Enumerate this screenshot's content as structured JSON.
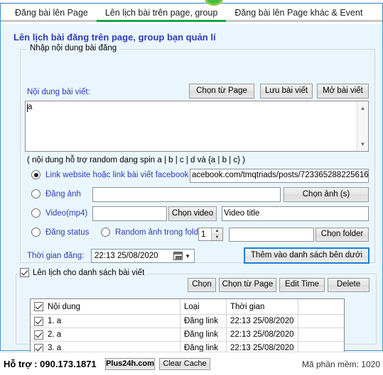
{
  "window": {
    "logo": "plus24h-logo-circle"
  },
  "tabs": [
    {
      "label": "Đăng bài lên Page",
      "active": false
    },
    {
      "label": "Lên lịch bài trên page, group",
      "active": true
    },
    {
      "label": "Đăng bài lên Page khác & Event",
      "active": false
    }
  ],
  "page": {
    "title": "Lên lịch bài đăng trên page, group bạn quản lí"
  },
  "content_group": {
    "legend": "Nhập nội dung bài đăng",
    "content_label": "Nội dung bài viết:",
    "buttons": {
      "choose_from_page": "Chọn từ Page",
      "save_post": "Lưu bài viết",
      "open_post": "Mở bài viết"
    },
    "textarea_value": "a",
    "hint": "( nội dung hỗ trợ random dạng spin a | b | c | d và {a | b | c} )",
    "options": {
      "link": {
        "label": "Link website hoặc link bài viết facebook :",
        "selected": true,
        "value": "acebook.com/tmqtriads/posts/723365288225616"
      },
      "image": {
        "label": "Đăng ảnh",
        "selected": false,
        "value": "",
        "button": "Chọn ảnh (s)"
      },
      "video": {
        "label": "Video(mp4)",
        "selected": false,
        "value": "",
        "button": "Chọn video",
        "title_value": "Video title"
      },
      "status": {
        "label": "Đăng status",
        "selected": false
      },
      "random_folder": {
        "label": "Random ảnh trong folder",
        "selected": false,
        "count": "1",
        "path": "",
        "button": "Chọn folder"
      }
    },
    "schedule_time_label": "Thời gian đăng:",
    "schedule_time_value": "22:13 25/08/2020",
    "add_button": "Thêm vào danh sách bên dưới"
  },
  "list_group": {
    "legend": "Lên lịch cho danh sách bài viết",
    "legend_checked": true,
    "buttons": {
      "choose": "Chọn",
      "choose_from_page": "Chọn từ Page",
      "edit_time": "Edit Time",
      "delete": "Delete"
    },
    "grid": {
      "header_checked": true,
      "columns": [
        "Nội dung",
        "Loại",
        "Thời gian",
        ""
      ],
      "rows": [
        {
          "checked": true,
          "content": "1. a",
          "type": "Đăng link",
          "time": "22:13 25/08/2020"
        },
        {
          "checked": true,
          "content": "2. a",
          "type": "Đăng link",
          "time": "22:13 25/08/2020"
        },
        {
          "checked": true,
          "content": "3. a",
          "type": "Đăng link",
          "time": "22:13 25/08/2020"
        }
      ]
    }
  },
  "statusbar": {
    "support": "Hỗ trợ : 090.173.1871",
    "plus24h_button": "Plus24h.com",
    "clear_cache_button": "Clear Cache",
    "version": "Mã phần mềm: 1020"
  },
  "colors": {
    "accent_blue": "#2f3bb5",
    "tab_active": "#18a64a",
    "page_bg": "#eaf6fd",
    "frame_border": "#3a8ec4"
  }
}
